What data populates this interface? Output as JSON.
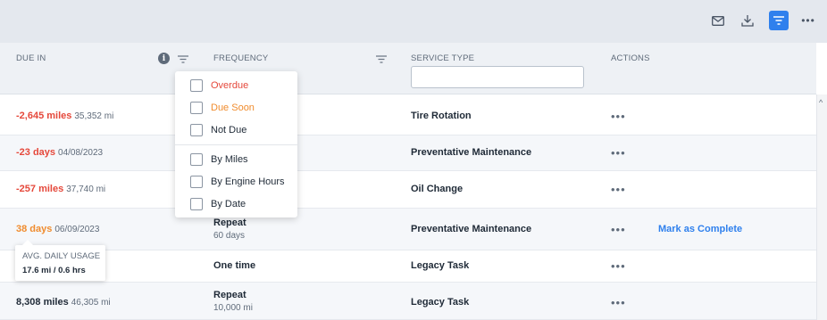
{
  "toolbar": {
    "icons": [
      "mail-icon",
      "download-icon",
      "filter-icon",
      "more-icon"
    ],
    "more_label": "•••",
    "accent_color": "#2f80ed"
  },
  "header": {
    "due_in": "DUE IN",
    "frequency": "FREQUENCY",
    "service_type": "SERVICE TYPE",
    "actions": "ACTIONS",
    "info_glyph": "i",
    "service_type_filter_value": ""
  },
  "filter_dropdown": {
    "status_options": [
      {
        "label": "Overdue",
        "color": "#e5483b",
        "checked": false
      },
      {
        "label": "Due Soon",
        "color": "#f08c2e",
        "checked": false
      },
      {
        "label": "Not Due",
        "color": "#1f2a37",
        "checked": false
      }
    ],
    "type_options": [
      {
        "label": "By Miles",
        "checked": false
      },
      {
        "label": "By Engine Hours",
        "checked": false
      },
      {
        "label": "By Date",
        "checked": false
      }
    ]
  },
  "rows": [
    {
      "due_main": "-2,645 miles",
      "due_sub": "35,352 mi",
      "status": "overdue",
      "freq_main": "",
      "freq_sub": "",
      "service": "Tire Rotation",
      "actions": "•••",
      "action_link": ""
    },
    {
      "due_main": "-23 days",
      "due_sub": "04/08/2023",
      "status": "overdue",
      "freq_main": "",
      "freq_sub": "",
      "service": "Preventative Maintenance",
      "actions": "•••",
      "action_link": ""
    },
    {
      "due_main": "-257 miles",
      "due_sub": "37,740 mi",
      "status": "overdue",
      "freq_main": "",
      "freq_sub": "",
      "service": "Oil Change",
      "actions": "•••",
      "action_link": ""
    },
    {
      "due_main": "38 days",
      "due_sub": "06/09/2023",
      "status": "due-soon",
      "freq_main": "Repeat",
      "freq_sub": "60 days",
      "service": "Preventative Maintenance",
      "actions": "•••",
      "action_link": "Mark as Complete"
    },
    {
      "due_main": "",
      "due_sub": "",
      "status": "not-due",
      "freq_main": "One time",
      "freq_sub": "",
      "service": "Legacy Task",
      "actions": "•••",
      "action_link": ""
    },
    {
      "due_main": "8,308 miles",
      "due_sub": "46,305 mi",
      "status": "not-due",
      "freq_main": "Repeat",
      "freq_sub": "10,000 mi",
      "service": "Legacy Task",
      "actions": "•••",
      "action_link": ""
    }
  ],
  "tooltip": {
    "title": "AVG. DAILY USAGE",
    "value": "17.6 mi / 0.6 hrs"
  },
  "scrollbar": {
    "up_glyph": "^"
  }
}
